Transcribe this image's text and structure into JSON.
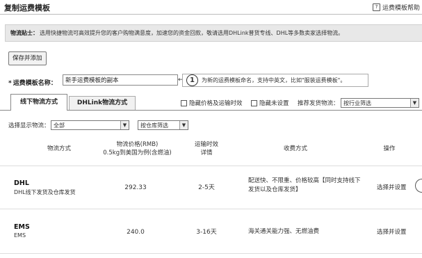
{
  "header": {
    "title": "复制运费模板",
    "help_label": "运费模板帮助",
    "help_icon": "question-icon"
  },
  "tip": {
    "label": "物流贴士：",
    "text": "选用快捷物流可高效提升您的客户购物满意度，加速您的资金回款，敬请选用DHLink普货专线、DHL等多数卖家选择物流。"
  },
  "save_button": "保存并添加",
  "template_name": {
    "label": "运费模板名称：",
    "value": "新手运费模板的副本",
    "hint_number": "1",
    "hint_text": "为新的运费模板命名，支持中英文，比如\"服装运费模板\"。"
  },
  "tabs": [
    {
      "label": "线下物流方式",
      "active": true
    },
    {
      "label": "DHLink物流方式",
      "active": false
    }
  ],
  "options": {
    "hide_price_time": "隐藏价格及运输时效",
    "hide_unset": "隐藏未设置",
    "recommend_label": "推荐发货物流：",
    "recommend_value": "按行业筛选"
  },
  "filters": {
    "display_label": "选择显示物流：",
    "display_value": "全部",
    "warehouse_value": "按仓库筛选"
  },
  "table": {
    "headers": {
      "method": "物流方式",
      "price": "物流价格(RMB)",
      "price_sub": "0.5kg到美国为例(含燃油)",
      "time": "运输时效",
      "time_sub": "详情",
      "fee": "收费方式",
      "action": "操作"
    },
    "rows": [
      {
        "name": "DHL",
        "desc": "DHL线下发货及仓库发货",
        "price": "292.33",
        "time": "2-5天",
        "fee": "配送快、不限重、价格较高【同时支持线下发货以及仓库发货】",
        "action": "选择并设置"
      },
      {
        "name": "EMS",
        "desc": "EMS",
        "price": "240.0",
        "time": "3-16天",
        "fee": "海关通关能力强、无燃油费",
        "action": "选择并设置"
      }
    ]
  }
}
